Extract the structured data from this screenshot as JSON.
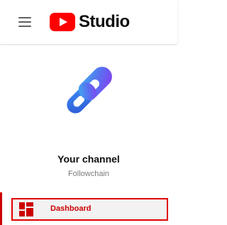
{
  "header": {
    "brand_text": "Studio",
    "menu_icon": "hamburger-menu-icon",
    "logo_icon": "youtube-play-logo-icon",
    "brand_color": "#ff0000"
  },
  "channel": {
    "title": "Your channel",
    "name": "Followchain",
    "avatar_icon": "chain-link-icon"
  },
  "nav": {
    "dashboard_label": "Dashboard",
    "dashboard_icon": "dashboard-icon",
    "active_color": "#cc0000"
  }
}
